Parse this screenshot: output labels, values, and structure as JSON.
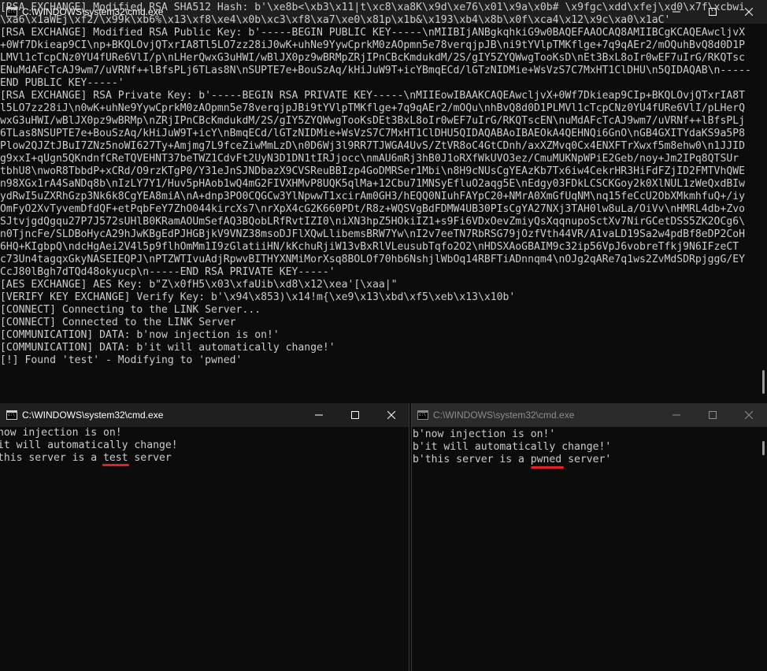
{
  "main_window": {
    "title": "C:\\WINDOWS\\system32\\cmd.exe",
    "lines": [
      "[RSA EXCHANGE] Modified RSA SHA512 Hash: b'\\xe8b<\\xb3\\x11|t\\xc8\\xa8K\\x9d\\xe76\\x01\\x9a\\x0b# \\x9fgc\\xdd\\xfej\\xd0\\x7f\\xcbwi",
      "\\xa6\\x1aWEj\\xf2/\\x99k\\xb6%\\x13\\xf8\\xe4\\x0b\\xc3\\xf8\\xa7\\xe0\\x81p\\x1b&\\x193\\xb4\\x8b\\x0f\\xca4\\x12\\x9c\\xa0\\x1aC'",
      "[RSA EXCHANGE] Modified RSA Public Key: b'-----BEGIN PUBLIC KEY-----\\nMIIBIjANBgkqhkiG9w0BAQEFAAOCAQ8AMIIBCgKCAQEAwcljvX",
      "+0Wf7Dkieap9CI\\np+BKQLOvjQTxrIA8Tl5LO7zz28iJ0wK+uhNe9YywCprkM0zAOpmn5e78verqjpJB\\ni9tYVlpTMKflge+7q9qAEr2/mOQuhBvQ8d0D1P",
      "LMVl1cTcpCNz0YU4fURe6VlI/p\\nLHerQwxG3uHWI/wBlJX0pz9wBRMpZRjIPnCBcKmdukdM/2S/gIY5ZYQWwgTooKsD\\nEt3BxL8oIr0wEF7uIrG/RKQTsc",
      "ENuMdAFcTcAJ9wm7/uVRNf++lBfsPLj6TLas8N\\nSUPTE7e+BouSzAq/kHiJuW9T+icYBmqECd/lGTzNIDMie+WsVzS7C7MxHT1ClDHU\\n5QIDAQAB\\n-----",
      "END PUBLIC KEY-----'",
      "[RSA EXCHANGE] RSA Private Key: b'-----BEGIN RSA PRIVATE KEY-----\\nMIIEowIBAAKCAQEAwcljvX+0Wf7Dkieap9CIp+BKQLOvjQTxrIA8T",
      "l5LO7zz28iJ\\n0wK+uhNe9YywCprkM0zAOpmn5e78verqjpJBi9tYVlpTMKflge+7q9qAEr2/mOQu\\nhBvQ8d0D1PLMVl1cTcpCNz0YU4fURe6VlI/pLHerQ",
      "wxG3uHWI/wBlJX0pz9wBRMp\\nZRjIPnCBcKmdukdM/2S/gIY5ZYQWwgTooKsDEt3BxL8oIr0wEF7uIrG/RKQTscEN\\nuMdAFcTcAJ9wm7/uVRNf++lBfsPLj",
      "6TLas8NSUPTE7e+BouSzAq/kHiJuW9T+icY\\nBmqECd/lGTzNIDMie+WsVzS7C7MxHT1ClDHU5QIDAQABAoIBAEOkA4QEHNQi6GnO\\nGB4GXITYdaKS9a5P8",
      "Plow2QJZtJBuI7ZNz5noWI627Ty+Amjmg7L9fceZiwMmLzD\\n0D6Wj3l9RR7TJWGA4UvS/ZtVR8oC4GtCDnh/axXZMvq0Cx4ENXFTrXwxf5m8ehw0\\n1JJID",
      "g9xxI+qUgn5QKndnfCReTQVEHNT37beTWZ1CdvFt2UyN3D1DN1tIRJjocc\\nmAU6mRj3hB0J1oRXfWkUVO3ez/CmuMUKNpWPiE2Geb/noy+Jm2IPq8QTSUr",
      "tbhU8\\nwoR8TbbdP+xCRd/O9rzKTgP0/Y31eJnSJNDbazX9CVSReuBBIzp4GoDMRSer1Mbi\\n8H9cNUsCgYEAzKb7Tx6iw4CekrHR3HiFdFZjID2FMTVhQWE",
      "n98XGx1rA4SaNDq8b\\nIzLY7Y1/Huv5pHAob1wQ4mG2FIVXHMvP8UQK5qlMa+12Cbu71MNSyEfluO2aqg5E\\nEdgy03FDkLCSCKGoy2k0XlNUL1zWeQxdBIw",
      "ydRwI5uZXRhGzp3Nk6k8CgYEA8miA\\nA+dnp3PO0CQGCw3YlNpwwT1xcirAm0GH3/hEQQ0NIuhFAYpC20+NMrA0XmGfUqNM\\nq15feCcU2ObXMkmhfuQ+/iy",
      "OmFyO2XvTyvemDfdQF+etPqbFeY7ZhO044kircXs7\\nrXpX4cG2K660PDt/R8z+WQSVgBdFDMW4UB30PIsCgYA27NXj3TAH0lw8uLa/OiVv\\nHMRL4db+Zvo",
      "SJtvjgdQgqu27P7J572sUHlB0KRamAOUmSefAQ3BQobLRfRvtIZI0\\niXN3hpZ5HOkiIZ1+s9Fi6VDxOevZmiyQsXqqnupoSctXv7NirGCetDSS5ZK2OCg6\\",
      "n0TjncFe/SLDBoHycA29hJwKBgEdPJHGBjkV9VNZ38msoDJFlXQwLlibemsBRW7Yw\\nI2v7eeTN7RbRSG79jOzfVth44VR/A1vaLD19Sa2w4pdBf8eDP2CoH",
      "6HQ+KIgbpQ\\ndcHgAei2V4l5p9flhOmMm1I9zGlatiiHN/kKchuRjiW13vBxRlVLeusubTqfo2O2\\nHDSXAoGBAIM9c32ip56VpJ6vobreTfkj9N6IFzeCT",
      "c73Un4tagqxGkyNASEIEQPJ\\nPTZWTIvuAdjRpwvBITHYXNMiMorXsq8BOLOf70hb6NshjlWbOq14RBFTiADnnqm4\\nOJg2qARe7q1ws2ZvMdSDRpjggG/EY",
      "CcJ80lBgh7dTQd48okyucp\\n-----END RSA PRIVATE KEY-----'",
      "[AES EXCHANGE] AES Key: b\"Z\\x0fH5\\x03\\xfaUib\\xd8\\x12\\xea'[\\xaa|\"",
      "[VERIFY KEY EXCHANGE] Verify Key: b'\\x94\\x853)\\x14!m{\\xe9\\x13\\xbd\\xf5\\xeb\\x13\\x10b'",
      "[CONNECT] Connecting to the LINK Server...",
      "[CONNECT] Connected to the LINK Server",
      "[COMMUNICATION] DATA: b'now injection is on!'",
      "[COMMUNICATION] DATA: b'it will automatically change!'",
      "[!] Found 'test' - Modifying to 'pwned'"
    ]
  },
  "left_window": {
    "title": "C:\\WINDOWS\\system32\\cmd.exe",
    "lines": [
      "now injection is on!",
      "it will automatically change!",
      "this server is a test server"
    ]
  },
  "right_window": {
    "title": "C:\\WINDOWS\\system32\\cmd.exe",
    "lines": [
      "b'now injection is on!'",
      "b'it will automatically change!'",
      "b'this server is a pwned server'"
    ]
  },
  "colors": {
    "terminal_bg": "#0c0c0c",
    "terminal_text": "#cccccc",
    "annotation_underline": "#e0202a",
    "titlebar_active": "#1f1f1f",
    "titlebar_inactive": "#2b2b2b"
  },
  "icons": [
    "cmd-app-icon",
    "minimize-icon",
    "maximize-icon",
    "close-icon"
  ]
}
